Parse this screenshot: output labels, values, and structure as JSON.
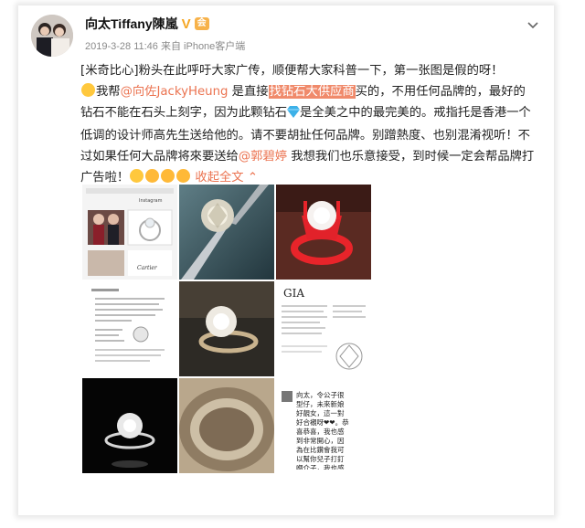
{
  "post": {
    "username": "向太Tiffany陳嵐",
    "verified_badge": "V",
    "member_badge": "会",
    "timestamp": "2019-3-28 11:46",
    "source": "来自 iPhone客户端",
    "text_1": "[米奇比心]粉头在此呼吁大家广传，顺便帮大家科普一下，第一张图是假的呀！",
    "text_2a": "我帮",
    "mention_1": "@向佐JackyHeung",
    "text_2b": " 是直接",
    "highlight": "找钻石大供应商",
    "text_2c": "买的，不用任何品牌的，最好的钻石不能在石头上刻字，因为此颗钻石",
    "text_2d": "是全美之中的最完美的。戒指托是香港一个低调的设计师高先生送给他的。请不要胡扯任何品牌。别蹭熱度、也别混淆视听！不过如果任何大品牌将來要送给",
    "mention_2": "@郭碧婷",
    "text_2e": " 我想我们也乐意接受，到时候一定会帮品牌打广告啦！",
    "collapse_label": "收起全文",
    "collapse_icon": "chevron-up-icon"
  },
  "images": {
    "tile1_brand": "Cartier",
    "tile1_header": "Instagram",
    "tile6_logo": "GIA",
    "tile9_message": "向太，令公子很型仔，未來新娘好靚女，這一對好合襯呀❤❤。恭喜恭喜，我也感到非常開心，因為在比鑽會我可以幫你兒子打釘嗰介子，我也感到榮耀，好想知道你兒子是怎樣求婚的，求婚的過程是怎樣的，太好啦。"
  },
  "colors": {
    "link": "#eb7350",
    "highlight_bg": "#f08a6b",
    "verified": "#f5a623"
  }
}
